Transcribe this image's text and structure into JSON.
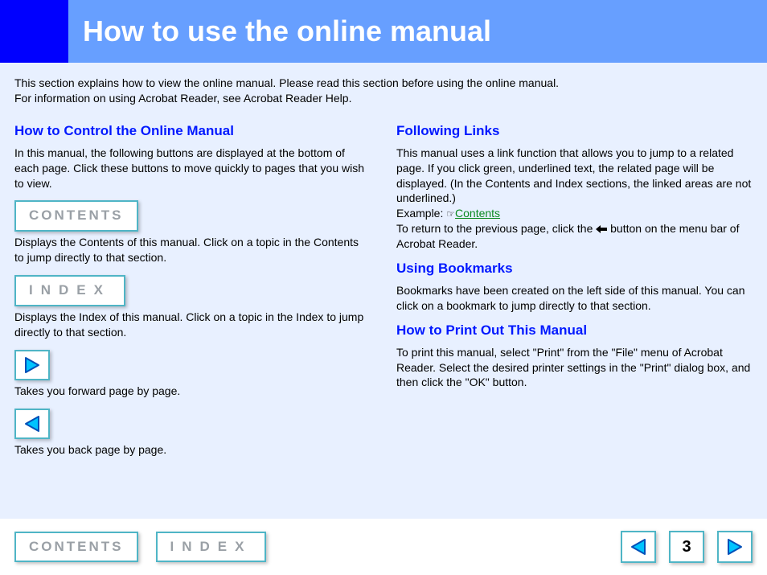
{
  "header": {
    "title": "How to use the online manual"
  },
  "intro": {
    "line1": "This section explains how to view the online manual. Please read this section before using the online manual.",
    "line2": "For information on using Acrobat Reader, see Acrobat Reader Help."
  },
  "left": {
    "h1": "How to Control the Online Manual",
    "p1": "In this manual, the following buttons are displayed at the bottom of each page. Click these buttons to move quickly to pages that you wish to view.",
    "contents_btn": "CONTENTS",
    "contents_desc": "Displays the Contents of this manual. Click on a topic in the Contents to jump directly to that section.",
    "index_btn": "INDEX",
    "index_desc": "Displays the Index of this manual. Click on a topic in the Index to jump directly to that section.",
    "fwd_desc": "Takes you forward page by page.",
    "back_desc": "Takes you back page by page."
  },
  "right": {
    "h1": "Following Links",
    "p1a": "This manual uses a link function that allows you to jump to a related page. If you click green, underlined text, the related page will be displayed. (In the Contents and Index sections, the linked areas are not underlined.)",
    "p1b_prefix": "Example: ",
    "p1b_pointer": "☞",
    "p1b_link": "Contents",
    "p1c_prefix": "To return to the previous page, click the ",
    "p1c_suffix": " button on the menu bar of Acrobat Reader.",
    "h2": "Using Bookmarks",
    "p2": "Bookmarks have been created on the left side of this manual. You can click on a bookmark to jump directly to that section.",
    "h3": "How to Print Out This Manual",
    "p3": "To print this manual, select \"Print\" from the \"File\" menu of Acrobat Reader. Select the desired printer settings in the \"Print\" dialog box, and then click the \"OK\" button."
  },
  "footer": {
    "contents": "CONTENTS",
    "index": "INDEX",
    "page": "3"
  }
}
